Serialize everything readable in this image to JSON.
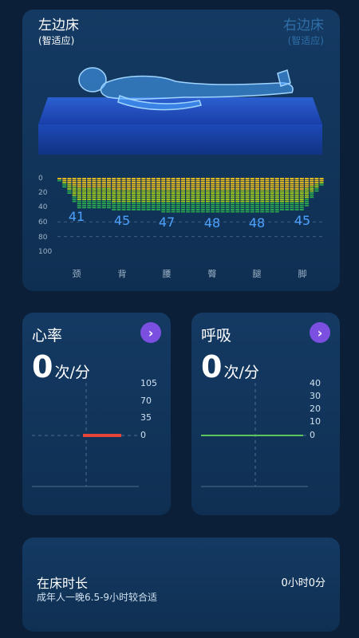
{
  "bed": {
    "left_title": "左边床",
    "left_sub": "(智适应)",
    "right_title": "右边床",
    "right_sub": "(智适应)"
  },
  "pressure_chart": {
    "type": "bar",
    "y_ticks": [
      "0",
      "20",
      "40",
      "60",
      "80",
      "100"
    ],
    "ylim": [
      0,
      100
    ],
    "categories": [
      "颈",
      "背",
      "腰",
      "臀",
      "腿",
      "脚"
    ],
    "values": [
      41,
      45,
      47,
      48,
      48,
      45
    ],
    "colors": {
      "top": "#f2c21c",
      "mid": "#a7d21a",
      "bottom": "#2ca84e"
    }
  },
  "heart_rate": {
    "title": "心率",
    "value": "0",
    "unit": "次/分",
    "chart_data": {
      "type": "line",
      "y_ticks": [
        "105",
        "70",
        "35",
        "0"
      ],
      "ylim": [
        0,
        105
      ],
      "series": [
        {
          "values": [
            0
          ]
        }
      ],
      "color": "#e8443a"
    }
  },
  "breathing": {
    "title": "呼吸",
    "value": "0",
    "unit": "次/分",
    "chart_data": {
      "type": "line",
      "y_ticks": [
        "40",
        "30",
        "20",
        "10",
        "0"
      ],
      "ylim": [
        0,
        40
      ],
      "series": [
        {
          "values": [
            0
          ]
        }
      ],
      "color": "#5cc65c"
    }
  },
  "bed_time": {
    "title": "在床时长",
    "note": "成年人一晚6.5-9小时较合适",
    "value": "0小时0分"
  }
}
